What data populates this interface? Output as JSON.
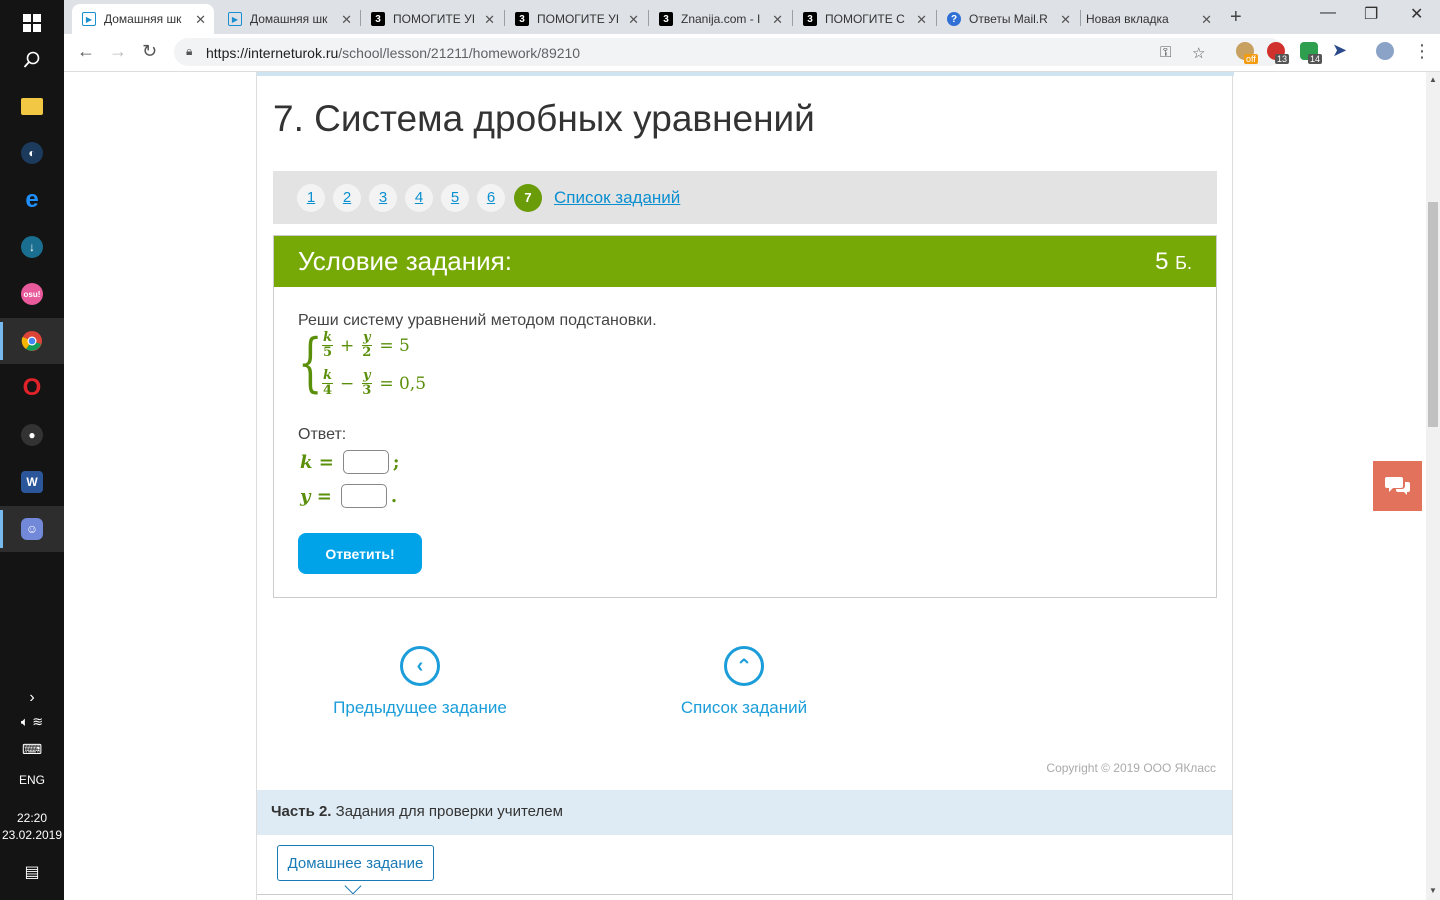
{
  "taskbar": {
    "icons": [
      "windows-logo",
      "search",
      "file-explorer",
      "steam",
      "edge",
      "download-app",
      "osu",
      "chrome",
      "opera",
      "mouse-app",
      "word",
      "discord"
    ],
    "osu_label": "osu!",
    "word_label": "W",
    "language": "ENG",
    "time": "22:20",
    "date": "23.02.2019"
  },
  "browser": {
    "tabs": [
      {
        "title": "Домашняя шк",
        "favicon": "interneturok-icon",
        "active": true
      },
      {
        "title": "Домашняя шк",
        "favicon": "interneturok-icon",
        "active": false
      },
      {
        "title": "ПОМОГИТЕ УІ",
        "favicon": "znanija-icon",
        "active": false
      },
      {
        "title": "ПОМОГИТЕ УІ",
        "favicon": "znanija-icon",
        "active": false
      },
      {
        "title": "Znanija.com - I",
        "favicon": "znanija-icon",
        "active": false
      },
      {
        "title": "ПОМОГИТЕ С",
        "favicon": "znanija-icon",
        "active": false
      },
      {
        "title": "Ответы Mail.R",
        "favicon": "mail-answers-icon",
        "active": false
      },
      {
        "title": "Новая вкладка",
        "favicon": "",
        "active": false
      }
    ],
    "favicon_letter": "3",
    "url_host": "https://interneturok.ru",
    "url_path": "/school/lesson/21211/homework/89210",
    "extensions": [
      {
        "name": "ext-off",
        "badge": "off",
        "color": "#c8a060"
      },
      {
        "name": "ext-red",
        "badge": "13",
        "color": "#d0312d"
      },
      {
        "name": "ext-green",
        "badge": "14",
        "color": "#2e9e4f"
      },
      {
        "name": "ext-cursor",
        "badge": "",
        "color": "#2b4a8b"
      }
    ]
  },
  "page": {
    "title": "7. Система дробных уравнений",
    "pager": {
      "pages": [
        "1",
        "2",
        "3",
        "4",
        "5",
        "6",
        "7"
      ],
      "current": "7",
      "list_link": "Список заданий"
    },
    "task": {
      "heading": "Условие задания:",
      "points_value": "5",
      "points_unit": "Б.",
      "instruction": "Реши систему уравнений методом подстановки.",
      "eq1": {
        "a_num": "k",
        "a_den": "5",
        "op": "+",
        "b_num": "y",
        "b_den": "2",
        "rhs": "= 5"
      },
      "eq2": {
        "a_num": "k",
        "a_den": "4",
        "op": "−",
        "b_num": "y",
        "b_den": "3",
        "rhs": "= 0,5"
      },
      "answer_label": "Ответ:",
      "answers": [
        {
          "var": "k",
          "eq": "=",
          "value": "",
          "tail": ";"
        },
        {
          "var": "y",
          "eq": "=",
          "value": "",
          "tail": "."
        }
      ],
      "submit_label": "Ответить!"
    },
    "nav": {
      "prev_label": "Предыдущее задание",
      "list_label": "Список заданий"
    },
    "copyright": "Copyright © 2019 ООО ЯКласс",
    "part2": {
      "bold": "Часть 2.",
      "text": " Задания для проверки учителем"
    },
    "homework_button": "Домашнее задание"
  },
  "colors": {
    "green": "#76a905",
    "blue": "#00a3e8",
    "chat": "#e2725b"
  }
}
